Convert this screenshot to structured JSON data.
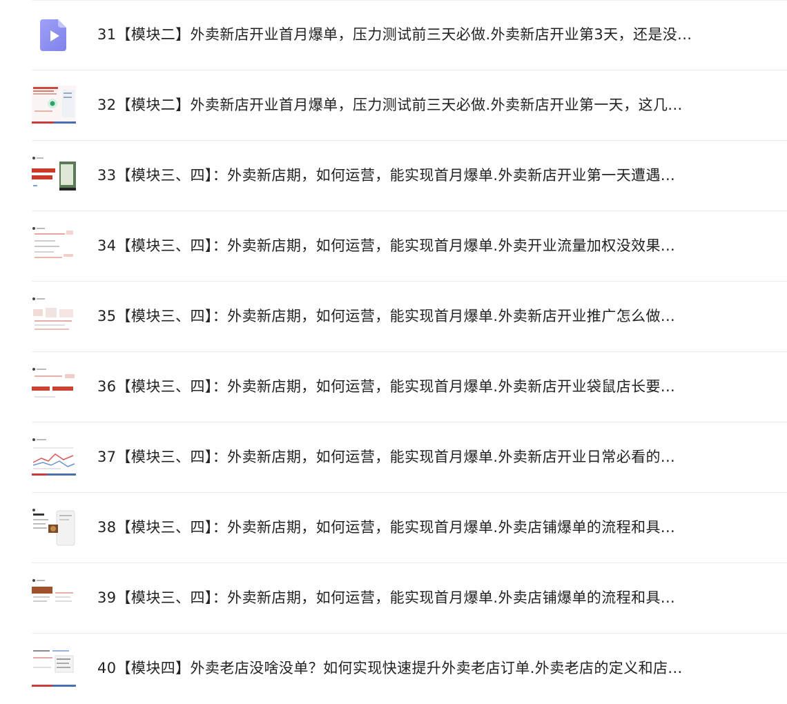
{
  "colors": {
    "accent_play": "#8c8ff0",
    "divider": "#ebebeb",
    "text": "#222222"
  },
  "lessons": [
    {
      "title": "31【模块二】外卖新店开业首月爆单，压力测试前三天必做.外卖新店开业第3天，还是没...",
      "thumb_icon": "video-play-icon"
    },
    {
      "title": "32【模块二】外卖新店开业首月爆单，压力测试前三天必做.外卖新店开业第一天，这几...",
      "thumb_icon": "slide-thumbnail"
    },
    {
      "title": "33【模块三、四】：外卖新店期，如何运营，能实现首月爆单.外卖新店开业第一天遭遇...",
      "thumb_icon": "slide-thumbnail"
    },
    {
      "title": "34【模块三、四】：外卖新店期，如何运营，能实现首月爆单.外卖开业流量加权没效果...",
      "thumb_icon": "slide-thumbnail"
    },
    {
      "title": "35【模块三、四】：外卖新店期，如何运营，能实现首月爆单.外卖新店开业推广怎么做...",
      "thumb_icon": "slide-thumbnail"
    },
    {
      "title": "36【模块三、四】：外卖新店期，如何运营，能实现首月爆单.外卖新店开业袋鼠店长要...",
      "thumb_icon": "slide-thumbnail"
    },
    {
      "title": "37【模块三、四】：外卖新店期，如何运营，能实现首月爆单.外卖新店开业日常必看的...",
      "thumb_icon": "slide-thumbnail"
    },
    {
      "title": "38【模块三、四】：外卖新店期，如何运营，能实现首月爆单.外卖店铺爆单的流程和具...",
      "thumb_icon": "slide-thumbnail"
    },
    {
      "title": "39【模块三、四】：外卖新店期，如何运营，能实现首月爆单.外卖店铺爆单的流程和具...",
      "thumb_icon": "slide-thumbnail"
    },
    {
      "title": "40【模块四】外卖老店没啥没单？如何实现快速提升外卖老店订单.外卖老店的定义和店...",
      "thumb_icon": "slide-thumbnail"
    }
  ]
}
